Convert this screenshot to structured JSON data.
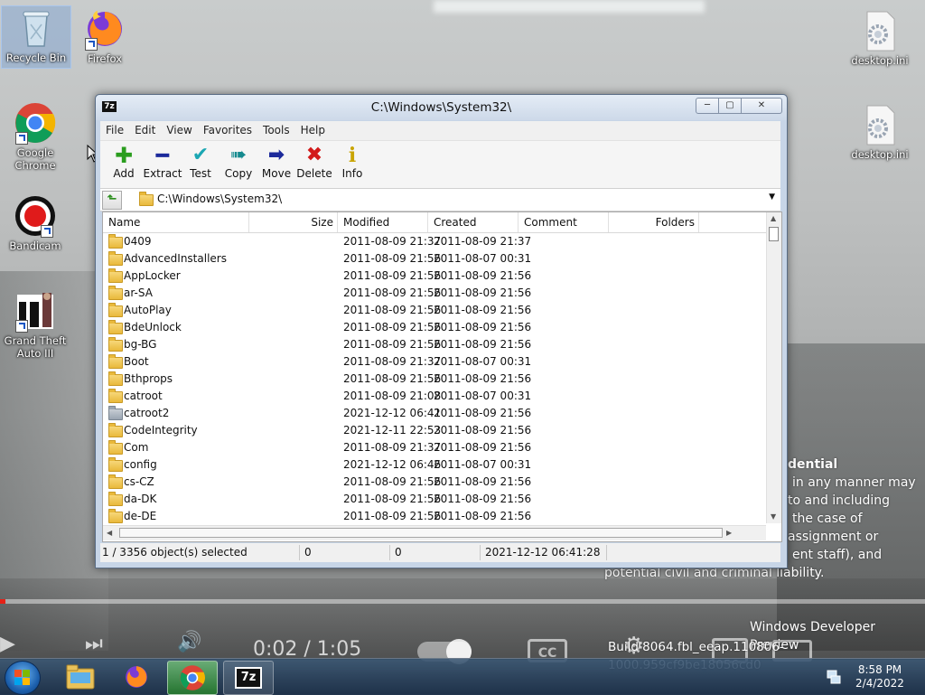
{
  "desktop": {
    "icons": [
      {
        "label": "Recycle Bin"
      },
      {
        "label": "Firefox"
      },
      {
        "label": "Google Chrome"
      },
      {
        "label": "Bandicam"
      },
      {
        "label": "Grand Theft Auto III"
      },
      {
        "label": "desktop.ini"
      },
      {
        "label": "desktop.ini"
      }
    ]
  },
  "overlay": {
    "heading": "dential",
    "lines": [
      "in any manner may",
      "to and including",
      "the case of",
      "assignment or",
      "ent staff), and",
      "potential civil and criminal liability."
    ],
    "watermark_line1": "Windows Developer Preview",
    "watermark_line2": "Build 8064.fbl_eeap.110806-1000.959cf9be18056cd0"
  },
  "video": {
    "time": "0:02 / 1:05",
    "progress_fraction": 0.006,
    "cc_label": "CC"
  },
  "window": {
    "app_icon": "7z",
    "title": "C:\\Windows\\System32\\",
    "menu": [
      "File",
      "Edit",
      "View",
      "Favorites",
      "Tools",
      "Help"
    ],
    "toolbar": [
      {
        "label": "Add",
        "icon": "plus-icon",
        "color": "#2a9d1e"
      },
      {
        "label": "Extract",
        "icon": "minus-icon",
        "color": "#1c2a9b"
      },
      {
        "label": "Test",
        "icon": "check-icon",
        "color": "#1ba7b3"
      },
      {
        "label": "Copy",
        "icon": "double-arrow-icon",
        "color": "#168a8f"
      },
      {
        "label": "Move",
        "icon": "arrow-right-icon",
        "color": "#1c2a9b"
      },
      {
        "label": "Delete",
        "icon": "x-icon",
        "color": "#d21a1a"
      },
      {
        "label": "Info",
        "icon": "info-icon",
        "color": "#c9a400"
      }
    ],
    "address": "C:\\Windows\\System32\\",
    "columns": [
      "Name",
      "Size",
      "Modified",
      "Created",
      "Comment",
      "Folders"
    ],
    "rows": [
      {
        "name": "0409",
        "modified": "2011-08-09 21:37",
        "created": "2011-08-09 21:37",
        "gray": false
      },
      {
        "name": "AdvancedInstallers",
        "modified": "2011-08-09 21:56",
        "created": "2011-08-07 00:31",
        "gray": false
      },
      {
        "name": "AppLocker",
        "modified": "2011-08-09 21:56",
        "created": "2011-08-09 21:56",
        "gray": false
      },
      {
        "name": "ar-SA",
        "modified": "2011-08-09 21:56",
        "created": "2011-08-09 21:56",
        "gray": false
      },
      {
        "name": "AutoPlay",
        "modified": "2011-08-09 21:56",
        "created": "2011-08-09 21:56",
        "gray": false
      },
      {
        "name": "BdeUnlock",
        "modified": "2011-08-09 21:56",
        "created": "2011-08-09 21:56",
        "gray": false
      },
      {
        "name": "bg-BG",
        "modified": "2011-08-09 21:56",
        "created": "2011-08-09 21:56",
        "gray": false
      },
      {
        "name": "Boot",
        "modified": "2011-08-09 21:37",
        "created": "2011-08-07 00:31",
        "gray": false
      },
      {
        "name": "Bthprops",
        "modified": "2011-08-09 21:56",
        "created": "2011-08-09 21:56",
        "gray": false
      },
      {
        "name": "catroot",
        "modified": "2011-08-09 21:08",
        "created": "2011-08-07 00:31",
        "gray": false
      },
      {
        "name": "catroot2",
        "modified": "2021-12-12 06:41",
        "created": "2011-08-09 21:56",
        "gray": true
      },
      {
        "name": "CodeIntegrity",
        "modified": "2021-12-11 22:53",
        "created": "2011-08-09 21:56",
        "gray": false
      },
      {
        "name": "Com",
        "modified": "2011-08-09 21:37",
        "created": "2011-08-09 21:56",
        "gray": false
      },
      {
        "name": "config",
        "modified": "2021-12-12 06:46",
        "created": "2011-08-07 00:31",
        "gray": false
      },
      {
        "name": "cs-CZ",
        "modified": "2011-08-09 21:56",
        "created": "2011-08-09 21:56",
        "gray": false
      },
      {
        "name": "da-DK",
        "modified": "2011-08-09 21:56",
        "created": "2011-08-09 21:56",
        "gray": false
      },
      {
        "name": "de-DE",
        "modified": "2011-08-09 21:56",
        "created": "2011-08-09 21:56",
        "gray": false
      }
    ],
    "status": {
      "selection": "1 / 3356 object(s) selected",
      "size1": "0",
      "size2": "0",
      "date": "2021-12-12 06:41:28"
    }
  },
  "taskbar": {
    "apps": [
      "Windows Explorer",
      "Firefox",
      "Google Chrome",
      "7-Zip"
    ],
    "time": "8:58 PM",
    "date": "2/4/2022"
  }
}
